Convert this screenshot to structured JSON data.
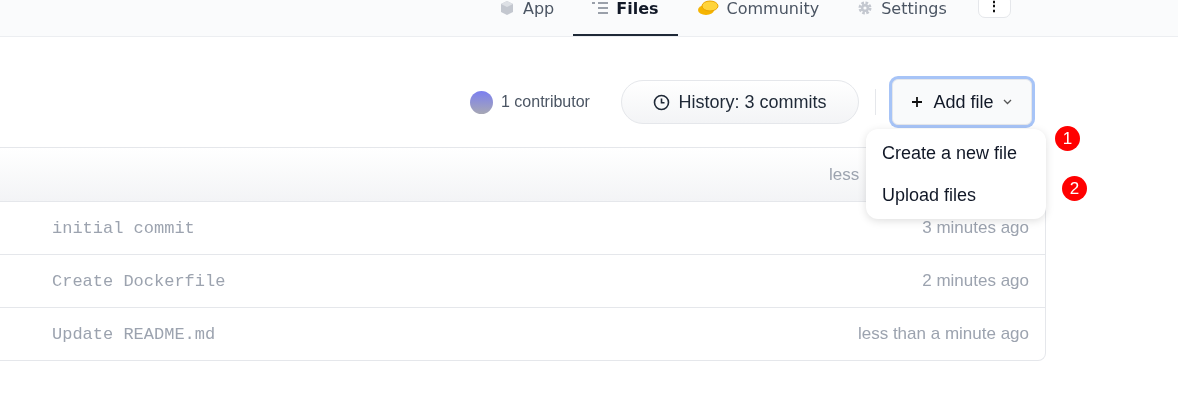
{
  "tabs": [
    {
      "label": "App",
      "selected": false
    },
    {
      "label": "Files",
      "selected": true
    },
    {
      "label": "Community",
      "selected": false
    },
    {
      "label": "Settings",
      "selected": false
    }
  ],
  "more_button": "⋮",
  "toolbar": {
    "contributors": "1 contributor",
    "history_button": "History: 3 commits",
    "add_file_button": "Add file"
  },
  "table": {
    "header_time": "less",
    "rows": [
      {
        "message": "initial commit",
        "time": "3 minutes ago"
      },
      {
        "message": "Create Dockerfile",
        "time": "2 minutes ago"
      },
      {
        "message": "Update README.md",
        "time": "less than a minute ago"
      }
    ]
  },
  "menu": {
    "items": [
      "Create a new file",
      "Upload files"
    ]
  },
  "annotations": [
    "1",
    "2"
  ]
}
